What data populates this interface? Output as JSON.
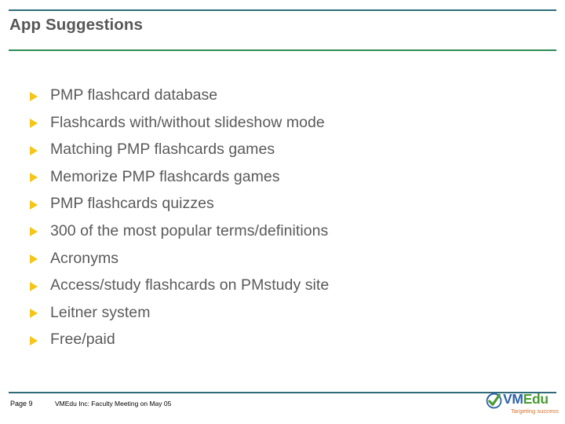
{
  "slide": {
    "title": "App Suggestions",
    "bullets": [
      {
        "text": "PMP flashcard database",
        "marker": "triangle-right-icon"
      },
      {
        "text": "Flashcards with/without slideshow mode",
        "marker": "triangle-right-icon"
      },
      {
        "text": "Matching PMP flashcards games",
        "marker": "triangle-right-icon"
      },
      {
        "text": "Memorize PMP flashcards games",
        "marker": "triangle-right-icon"
      },
      {
        "text": "PMP flashcards quizzes",
        "marker": "triangle-right-icon"
      },
      {
        "text": "300 of the most popular terms/definitions",
        "marker": "triangle-right-icon"
      },
      {
        "text": "Acronyms",
        "marker": "triangle-right-icon"
      },
      {
        "text": "Access/study flashcards on PMstudy site",
        "marker": "triangle-right-icon"
      },
      {
        "text": "Leitner system",
        "marker": "triangle-right-icon"
      },
      {
        "text": "Free/paid",
        "marker": "triangle-right-icon"
      }
    ]
  },
  "footer": {
    "page_number": "Page 9",
    "note": "VMEdu Inc: Faculty Meeting on May 05"
  },
  "logo": {
    "mark": "checkmark-circle-icon",
    "word_first": "VM",
    "word_second": "Edu",
    "tagline": "Targeting success"
  },
  "colors": {
    "rule_teal": "#2f6b78",
    "rule_green": "#2e8b57",
    "title_gray": "#575757",
    "body_gray": "#5a5a5a",
    "bullet_gold": "#f5c518",
    "logo_blue": "#2e62a8",
    "logo_green": "#4a9b34",
    "tagline_orange": "#d4722a"
  }
}
